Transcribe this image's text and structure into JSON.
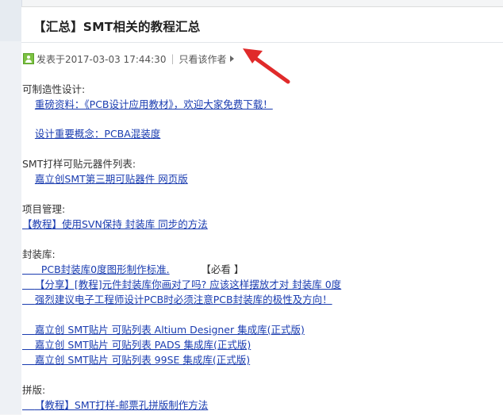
{
  "post": {
    "title": "【汇总】SMT相关的教程汇总",
    "posted_at": "发表于2017-03-03 17:44:30",
    "separator": "|",
    "only_author": "只看该作者"
  },
  "sections": [
    {
      "heading": "可制造性设计:",
      "links": [
        "重磅资料：《PCB设计应用教材》，欢迎大家免费下载！",
        "设计重要概念：PCBA混装度"
      ]
    },
    {
      "heading": "SMT打样可贴元器件列表:",
      "links": [
        "嘉立创SMT第三期可贴器件 网页版"
      ]
    },
    {
      "heading": "项目管理:",
      "links": [
        "【教程】使用SVN保持 封装库 同步的方法"
      ]
    },
    {
      "heading": "封装库:",
      "links": [
        "PCB封装库0度图形制作标准.",
        "【分享】[教程]元件封装库你画对了吗? 应该这样摆放才对 封装库 0度",
        "强烈建议电子工程师设计PCB时必须注意PCB封装库的极性及方向！",
        "嘉立创 SMT贴片 可贴列表 Altium Designer 集成库(正式版)",
        "嘉立创 SMT贴片 可贴列表 PADS 集成库(正式版)",
        "嘉立创 SMT贴片 可贴列表 99SE 集成库(正式版)"
      ],
      "tag": "【必看 】"
    },
    {
      "heading": "拼版:",
      "links": [
        "【教程】SMT打样-邮票孔拼版制作方法"
      ]
    }
  ],
  "annotation_color": "#e02a2a",
  "link_color": "#1a3cb0",
  "icons": [
    "user-icon",
    "arrow-right-icon"
  ]
}
